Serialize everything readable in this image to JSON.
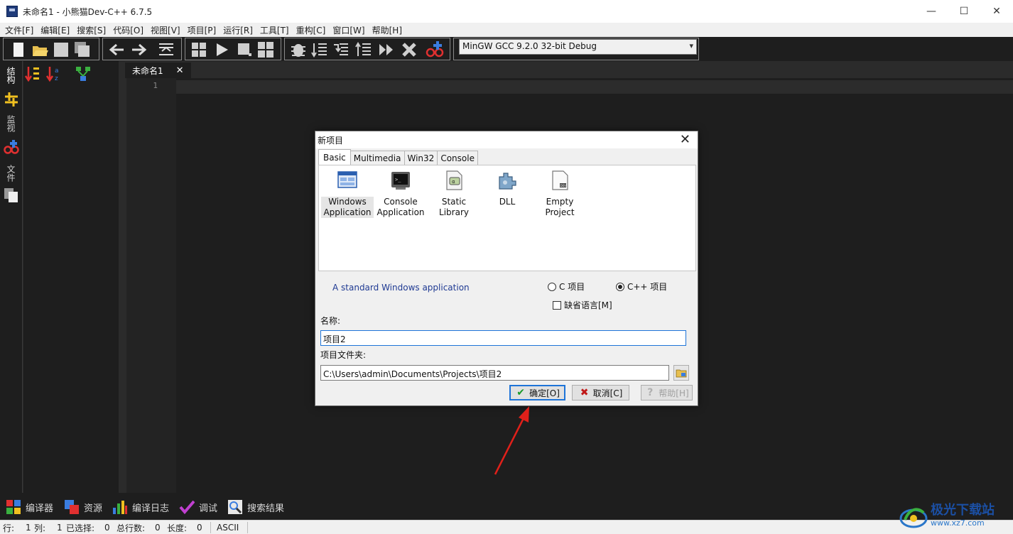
{
  "window": {
    "title": "未命名1 - 小熊猫Dev-C++ 6.7.5",
    "minimize": "—",
    "maximize": "☐",
    "close": "✕"
  },
  "menu": [
    "文件[F]",
    "编辑[E]",
    "搜索[S]",
    "代码[O]",
    "视图[V]",
    "项目[P]",
    "运行[R]",
    "工具[T]",
    "重构[C]",
    "窗口[W]",
    "帮助[H]"
  ],
  "toolbar": {
    "compiler": "MinGW GCC 9.2.0 32-bit Debug"
  },
  "side_tabs": {
    "structure": "结构",
    "watch": "监视",
    "files": "文件"
  },
  "editor": {
    "tab_label": "未命名1",
    "line_number": "1"
  },
  "bottom_tabs": [
    "编译器",
    "资源",
    "编译日志",
    "调试",
    "搜索结果"
  ],
  "status": {
    "row_label": "行:",
    "row_value": "1",
    "col_label": "列:",
    "col_value": "1",
    "selected_label": "已选择:",
    "selected_value": "0",
    "total_lines_label": "总行数:",
    "total_lines_value": "0",
    "length_label": "长度:",
    "length_value": "0",
    "encoding": "ASCII"
  },
  "dialog": {
    "title": "新项目",
    "tabs": [
      "Basic",
      "Multimedia",
      "Win32",
      "Console"
    ],
    "templates": [
      {
        "line1": "Windows",
        "line2": "Application",
        "icon": "windows-app-icon"
      },
      {
        "line1": "Console",
        "line2": "Application",
        "icon": "console-app-icon"
      },
      {
        "line1": "Static Library",
        "line2": "",
        "icon": "static-library-icon"
      },
      {
        "line1": "DLL",
        "line2": "",
        "icon": "dll-icon"
      },
      {
        "line1": "Empty",
        "line2": "Project",
        "icon": "empty-project-icon"
      }
    ],
    "description": "A standard Windows application",
    "radio_c": "C 项目",
    "radio_cpp": "C++ 项目",
    "default_lang": "缺省语言[M]",
    "name_label": "名称:",
    "name_value": "项目2",
    "folder_label": "项目文件夹:",
    "folder_value": "C:\\Users\\admin\\Documents\\Projects\\项目2",
    "ok": "确定[O]",
    "cancel": "取消[C]",
    "help": "帮助[H]"
  },
  "watermark": {
    "name": "极光下载站",
    "url": "www.xz7.com"
  },
  "colors": {
    "accent": "#1e74d8",
    "annotation_arrow": "#e0201a",
    "dark_bg": "#1e1e1e"
  }
}
